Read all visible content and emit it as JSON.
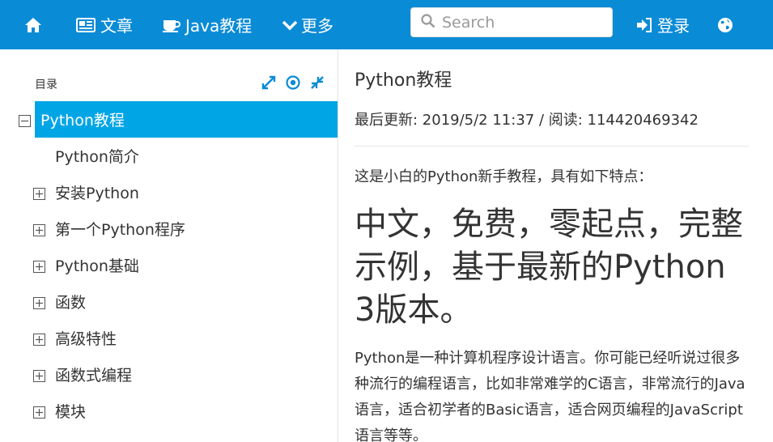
{
  "nav": {
    "home_icon": "home-icon",
    "articles": "文章",
    "java": "Java教程",
    "more": "更多",
    "login": "登录",
    "globe_icon": "globe-icon"
  },
  "search": {
    "placeholder": "Search"
  },
  "sidebar": {
    "heading": "目录",
    "tools": [
      "expand-icon",
      "locate-icon",
      "collapse-icon"
    ],
    "items": [
      {
        "label": "Python教程",
        "expanded": true,
        "active": true
      },
      {
        "label": "Python简介",
        "leaf": true
      },
      {
        "label": "安装Python"
      },
      {
        "label": "第一个Python程序"
      },
      {
        "label": "Python基础"
      },
      {
        "label": "函数"
      },
      {
        "label": "高级特性"
      },
      {
        "label": "函数式编程"
      },
      {
        "label": "模块"
      }
    ]
  },
  "content": {
    "title": "Python教程",
    "meta": "最后更新: 2019/5/2 11:37 / 阅读: 114420469342",
    "intro": "这是小白的Python新手教程，具有如下特点：",
    "headline": "中文，免费，零起点，完整示例，基于最新的Python 3版本。",
    "paragraph": "Python是一种计算机程序设计语言。你可能已经听说过很多种流行的编程语言，比如非常难学的C语言，非常流行的Java语言，适合初学者的Basic语言，适合网页编程的JavaScript语言等等。"
  },
  "colors": {
    "topbar": "#0a8bd6",
    "active": "#00a5e5"
  }
}
